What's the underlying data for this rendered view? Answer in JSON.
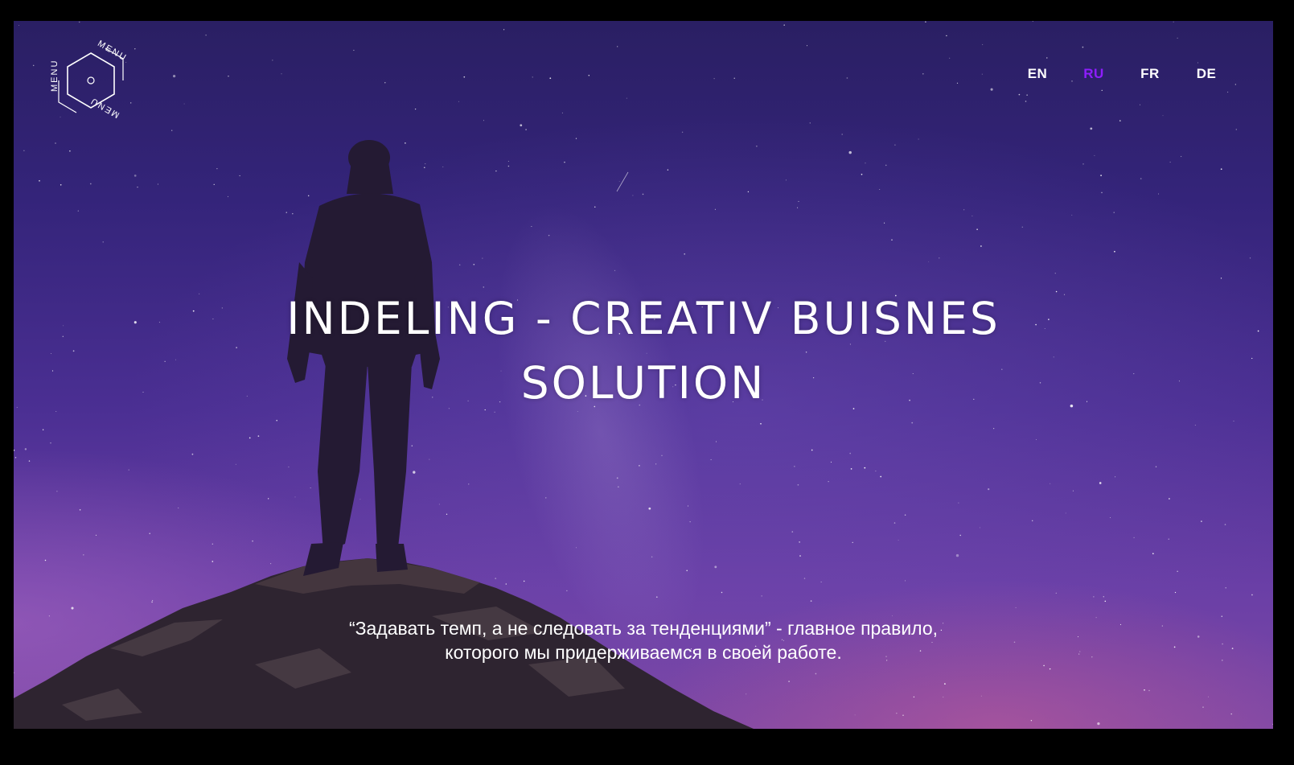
{
  "menu": {
    "label": "MENU"
  },
  "languages": [
    {
      "code": "EN",
      "active": false
    },
    {
      "code": "RU",
      "active": true
    },
    {
      "code": "FR",
      "active": false
    },
    {
      "code": "DE",
      "active": false
    }
  ],
  "hero": {
    "title_line1": "INDELING - CREATIV BUISNES",
    "title_line2": "SOLUTION",
    "tagline_line1": "“Задавать темп, а не следовать за тенденциями” - главное правило,",
    "tagline_line2": "которого мы придерживаемся в своей работе."
  },
  "colors": {
    "accent": "#8f1dff",
    "text": "#ffffff",
    "sky_top": "#2a1f63",
    "sky_bottom": "#7d48a6",
    "frame": "#000000"
  },
  "icons": {
    "menu": "hexagon-menu-icon",
    "background": "starry-night-hiker-photo"
  }
}
